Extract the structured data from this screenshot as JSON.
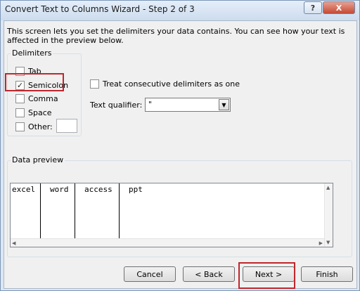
{
  "window": {
    "title": "Convert Text to Columns Wizard - Step 2 of 3",
    "help_glyph": "?",
    "close_glyph": "X"
  },
  "description": "This screen lets you set the delimiters your data contains.  You can see how your text is affected in the preview below.",
  "delimiters": {
    "legend": "Delimiters",
    "tab": {
      "label": "Tab",
      "checked": false
    },
    "semicolon": {
      "label": "Semicolon",
      "checked": true
    },
    "comma": {
      "label": "Comma",
      "checked": false
    },
    "space": {
      "label": "Space",
      "checked": false
    },
    "other": {
      "label": "Other:",
      "checked": false,
      "value": ""
    }
  },
  "consecutive": {
    "label": "Treat consecutive delimiters as one",
    "checked": false
  },
  "text_qualifier": {
    "label": "Text qualifier:",
    "value": "\""
  },
  "preview": {
    "legend": "Data preview",
    "columns": [
      "excel",
      "word",
      "access",
      "ppt"
    ]
  },
  "buttons": {
    "cancel": "Cancel",
    "back": "< Back",
    "next": "Next >",
    "finish": "Finish"
  },
  "check_glyph": "✓",
  "dropdown_glyph": "▼",
  "colors": {
    "highlight": "#c0262d",
    "titlebar": "#cddcee",
    "close_button": "#c44a35"
  }
}
